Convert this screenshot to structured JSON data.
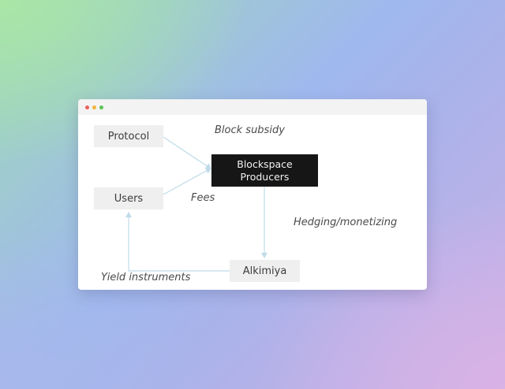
{
  "window": {
    "controls": [
      "close",
      "minimize",
      "maximize"
    ]
  },
  "diagram": {
    "nodes": {
      "protocol": "Protocol",
      "users": "Users",
      "producers_line1": "Blockspace",
      "producers_line2": "Producers",
      "alkimiya": "Alkimiya"
    },
    "edge_labels": {
      "block_subsidy": "Block subsidy",
      "fees": "Fees",
      "hedging": "Hedging/monetizing",
      "yield": "Yield instruments"
    },
    "edges": [
      {
        "from": "Protocol",
        "to": "Blockspace Producers",
        "label": "Block subsidy"
      },
      {
        "from": "Users",
        "to": "Blockspace Producers",
        "label": "Fees"
      },
      {
        "from": "Blockspace Producers",
        "to": "Alkimiya",
        "label": "Hedging/monetizing"
      },
      {
        "from": "Alkimiya",
        "to": "Users",
        "label": "Yield instruments"
      }
    ],
    "colors": {
      "edge": "#bfdbe8",
      "node_fill": "#efefef",
      "highlight_fill": "#161616"
    }
  }
}
